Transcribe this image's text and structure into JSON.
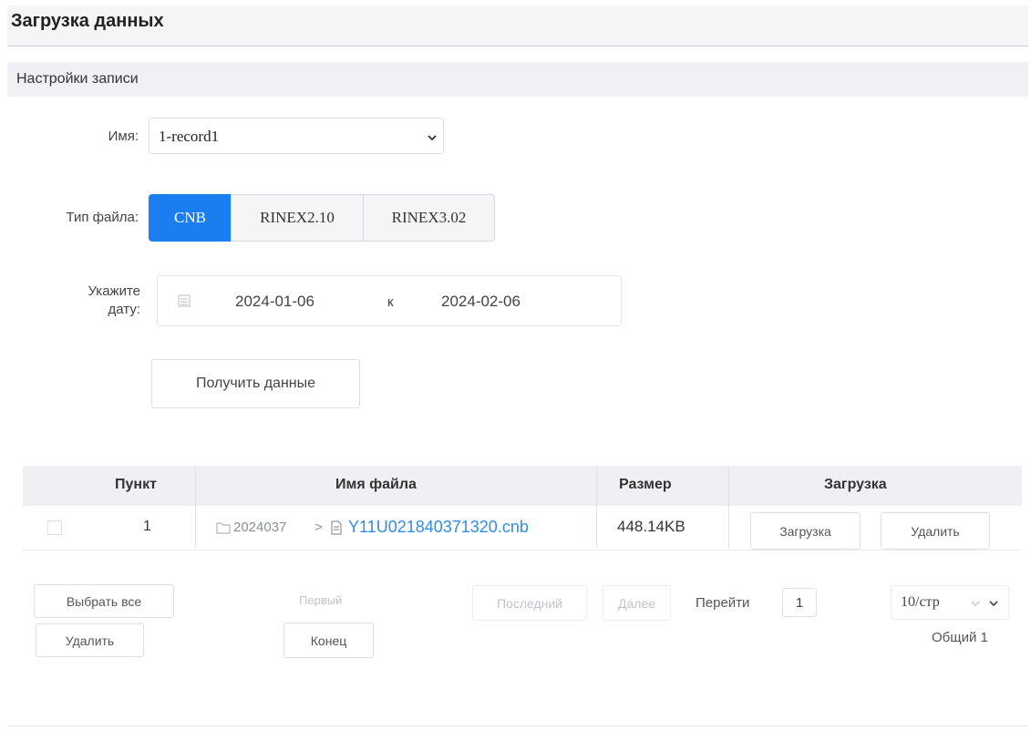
{
  "page": {
    "title": "Загрузка данных",
    "section_title": "Настройки записи"
  },
  "form": {
    "name_label": "Имя:",
    "name_value": "1-record1",
    "file_type_label": "Тип файла:",
    "file_types": [
      "CNB",
      "RINEX2.10",
      "RINEX3.02"
    ],
    "file_type_selected": "CNB",
    "date_label_line1": "Укажите",
    "date_label_line2": "дату:",
    "date_from": "2024-01-06",
    "date_sep": "к",
    "date_to": "2024-02-06",
    "get_data_button": "Получить данные"
  },
  "table": {
    "headers": {
      "item": "Пункт",
      "filename": "Имя файла",
      "size": "Размер",
      "download": "Загрузка"
    },
    "rows": [
      {
        "item": "1",
        "folder": "2024037",
        "path_sep": ">",
        "filename": "Y11U021840371320.cnb",
        "size": "448.14KB",
        "download_button": "Загрузка",
        "delete_button": "Удалить"
      }
    ]
  },
  "footer": {
    "select_all": "Выбрать все",
    "delete": "Удалить",
    "first": "Первый",
    "end": "Конец",
    "last": "Последний",
    "next": "Далее",
    "goto_label": "Перейти",
    "page_number": "1",
    "page_size": "10/стр",
    "total": "Общий 1"
  },
  "colors": {
    "accent": "#1a7ef0",
    "link": "#2d8cf0"
  },
  "icons": [
    "chevron-down-icon",
    "calendar-icon",
    "folder-icon",
    "file-icon"
  ]
}
